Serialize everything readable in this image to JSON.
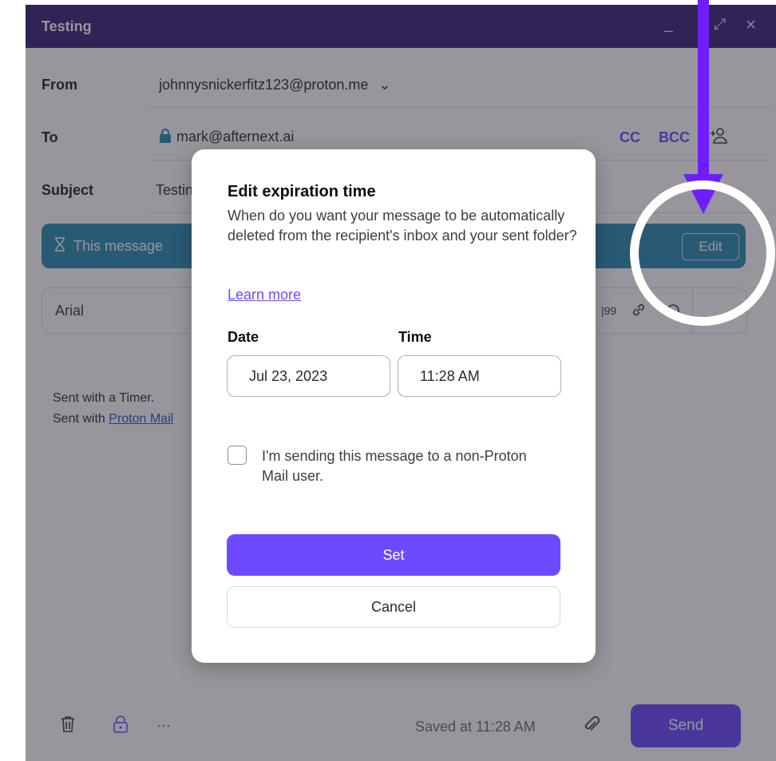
{
  "window": {
    "title": "Testing",
    "minimize_glyph": "_",
    "maximize_glyph": "⤢",
    "close_glyph": "×"
  },
  "fields": {
    "from_label": "From",
    "from_value": "johnnysnickerfitz123@proton.me",
    "from_chevron": "⌄",
    "to_label": "To",
    "to_value": "mark@afternext.ai",
    "cc_label": "CC",
    "bcc_label": "BCC",
    "subject_label": "Subject",
    "subject_value": "Testing"
  },
  "banner": {
    "text": "This message",
    "edit_label": "Edit",
    "icon": "hourglass-icon"
  },
  "toolbar": {
    "font": "Arial",
    "quote_glyph": "|99"
  },
  "body": {
    "line1": "Sent with a Timer.",
    "line2_prefix": "Sent with ",
    "line2_link": "Proton Mail"
  },
  "footer": {
    "saved_text": "Saved at 11:28 AM",
    "more_glyph": "···",
    "send_label": "Send"
  },
  "modal": {
    "title": "Edit expiration time",
    "description": "When do you want your message to be automatically deleted from the recipient's inbox and your sent folder?",
    "learn_more": "Learn more",
    "date_label": "Date",
    "date_value": "Jul 23, 2023",
    "time_label": "Time",
    "time_value": "11:28 AM",
    "checkbox_label": "I'm sending this message to a non-Proton Mail user.",
    "set_label": "Set",
    "cancel_label": "Cancel"
  },
  "colors": {
    "titlebar": "#3c2478",
    "accent": "#6d4aff",
    "banner": "#2d8cb3",
    "annotation_arrow": "#6f1dff",
    "annotation_ring": "#ffffff"
  }
}
